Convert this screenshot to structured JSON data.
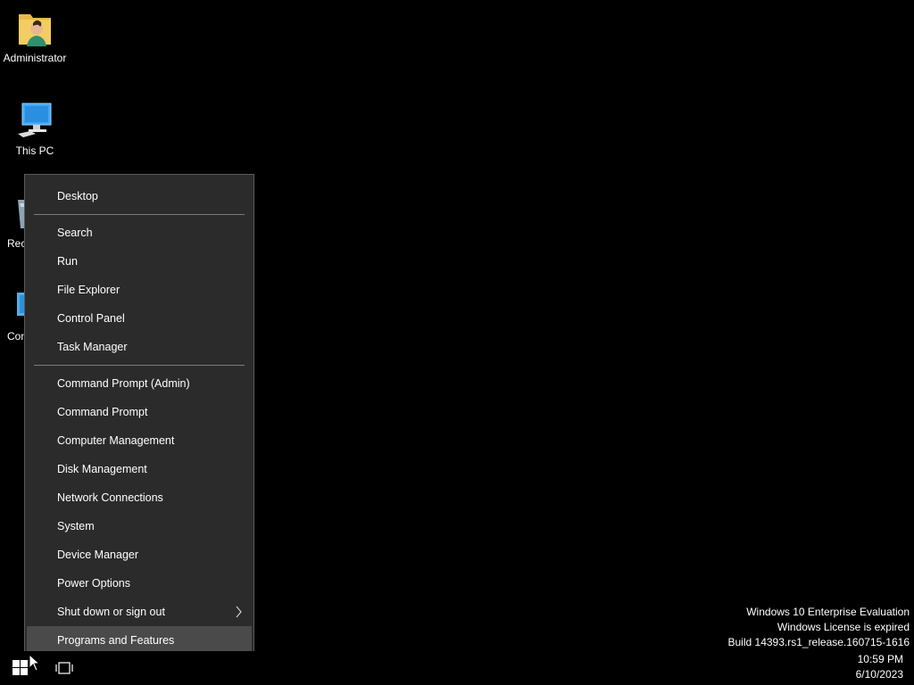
{
  "desktop": {
    "icons": [
      {
        "label": "Administrator",
        "icon": "user-folder-icon"
      },
      {
        "label": "This PC",
        "icon": "computer-icon"
      },
      {
        "label": "Recycle Bin",
        "visible_label": "Rec",
        "icon": "recycle-bin-icon"
      },
      {
        "label": "Control Panel",
        "visible_label": "Cont",
        "icon": "control-panel-icon"
      }
    ]
  },
  "menu": {
    "items": [
      {
        "label": "Desktop"
      },
      {
        "label": "Search"
      },
      {
        "label": "Run"
      },
      {
        "label": "File Explorer"
      },
      {
        "label": "Control Panel"
      },
      {
        "label": "Task Manager"
      },
      {
        "label": "Command Prompt (Admin)"
      },
      {
        "label": "Command Prompt"
      },
      {
        "label": "Computer Management"
      },
      {
        "label": "Disk Management"
      },
      {
        "label": "Network Connections"
      },
      {
        "label": "System"
      },
      {
        "label": "Device Manager"
      },
      {
        "label": "Power Options"
      },
      {
        "label": "Shut down or sign out",
        "submenu": true
      },
      {
        "label": "Programs and Features",
        "highlighted": true
      }
    ],
    "submenu_arrow": ">"
  },
  "watermark": {
    "line1": "Windows 10 Enterprise Evaluation",
    "line2": "Windows License is expired",
    "line3": "Build 14393.rs1_release.160715-1616"
  },
  "taskbar": {
    "time": "10:59 PM",
    "date": "6/10/2023"
  },
  "colors": {
    "menu_bg": "#2b2b2b",
    "menu_highlight": "#4a4a4a",
    "desktop_bg": "#000000"
  }
}
